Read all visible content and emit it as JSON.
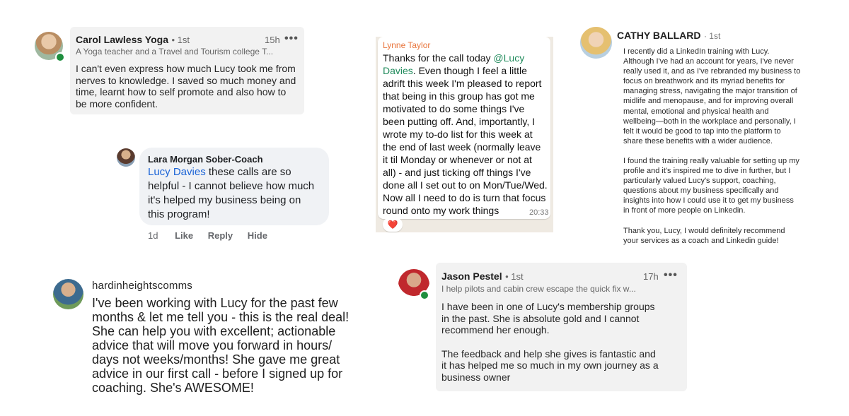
{
  "card1": {
    "name": "Carol Lawless Yoga",
    "degree": "• 1st",
    "time": "15h",
    "more": "•••",
    "subtitle": "A Yoga teacher and a Travel and Tourism college T...",
    "lines": [
      "I can't even express how much Lucy took me from",
      "nerves to knowledge. I saved so much money and",
      "time, learnt how to self promote and also how to",
      "be more confident."
    ]
  },
  "card2": {
    "name": "Lara Morgan Sober-Coach",
    "mention": "Lucy Davies",
    "first_rest": " these calls are so",
    "lines": [
      "helpful - I cannot believe how much",
      "it's helped my business being on",
      "this program!"
    ],
    "actions": {
      "age": "1d",
      "like": "Like",
      "reply": "Reply",
      "hide": "Hide"
    }
  },
  "card3": {
    "name": "Lynne Taylor",
    "line1_prefix": "Thanks for the call today ",
    "mention_part1": "@Lucy",
    "mention_part2": "Davies",
    "line2_rest": ".  Even though I feel a little",
    "lines": [
      "adrift this week I'm pleased to report",
      "that being in this group has got me",
      "motivated to do some things I've",
      "been putting off. And, importantly, I",
      "wrote my to-do list for this week at",
      "the end of last week (normally leave",
      "it til Monday or whenever or not at",
      "all) - and just ticking off things I've",
      "done all I set out to on Mon/Tue/Wed.",
      "Now all I need to do is turn that focus",
      "round onto my work things"
    ],
    "time": "20:33",
    "reaction": "❤️"
  },
  "card4": {
    "name": "CATHY BALLARD",
    "degree": "· 1st",
    "para1": [
      "I recently did a LinkedIn training with Lucy.",
      "Although I've had an account for years, I've never",
      "really used it, and as I've rebranded my business to",
      "focus on breathwork and its myriad benefits for",
      "managing stress,  navigating the major transition of",
      "midlife and menopause, and for improving overall",
      "mental, emotional and physical health and",
      "wellbeing—both in the workplace and personally, I",
      "felt it would be good to tap into the platform to",
      "share these benefits with a wider audience."
    ],
    "para2": [
      "I found the training really valuable for setting up my",
      "profile and it's inspired me to dive in further, but I",
      "particularly valued Lucy's support, coaching,",
      "questions about my business specifically and",
      "insights into how I could use it to get my business",
      "in front of more people on Linkedin."
    ],
    "para3": [
      "Thank you, Lucy, I would definitely recommend",
      "your services as a coach and Linkedin guide!"
    ]
  },
  "card5": {
    "name": "hardinheightscomms",
    "lines": [
      "I've been working with Lucy for the past few",
      "months & let me tell you - this is the real deal!",
      "She can help you with excellent; actionable",
      "advice that will move you forward in hours/",
      "days not weeks/months!  She gave me great",
      "advice in our first call - before I signed up for",
      "coaching. She's AWESOME!"
    ]
  },
  "card6": {
    "name": "Jason Pestel",
    "degree": "• 1st",
    "time": "17h",
    "more": "•••",
    "subtitle": "I help pilots and cabin crew escape the quick fix w...",
    "para1": [
      "I have been in one of Lucy's membership groups",
      "in the past. She is absolute gold and I cannot",
      "recommend her enough."
    ],
    "para2": [
      "The feedback and help she gives is fantastic and",
      "it has helped me so much in my own journey as a",
      "business owner"
    ]
  },
  "colors": {
    "link_blue": "#1a63d6",
    "whatsapp_name": "#e8743b",
    "whatsapp_mention": "#1f8a5b",
    "online_green": "#1e8e3e"
  },
  "icons": [
    "avatar-icon",
    "online-status-icon",
    "more-options-icon",
    "heart-reaction-icon"
  ]
}
